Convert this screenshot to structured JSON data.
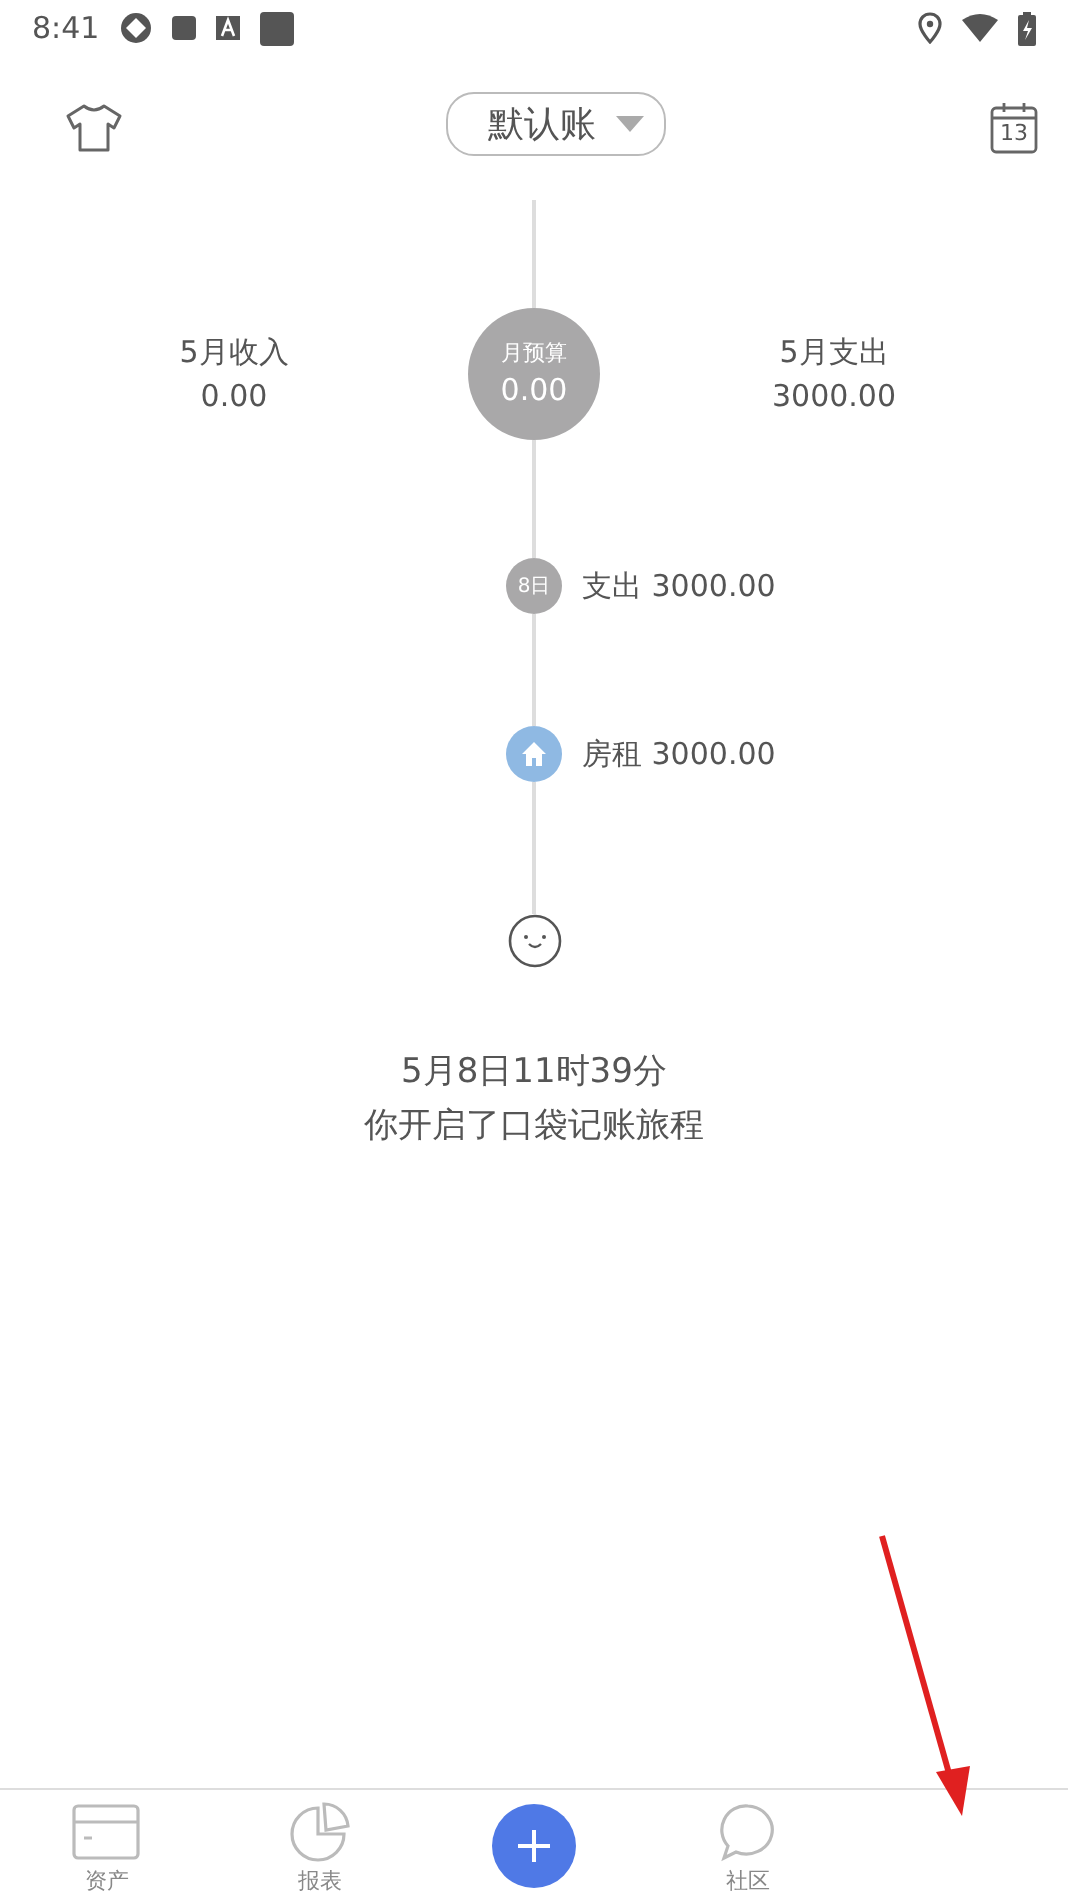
{
  "status_bar": {
    "time": "8:41"
  },
  "header": {
    "account": "默认账",
    "calendar_day": "13"
  },
  "summary": {
    "income": {
      "label": "5月收入",
      "amount": "0.00"
    },
    "budget": {
      "label": "月预算",
      "amount": "0.00"
    },
    "expense": {
      "label": "5月支出",
      "amount": "3000.00"
    }
  },
  "timeline": [
    {
      "kind": "date",
      "badge": "8日",
      "text": "支出 3000.00"
    },
    {
      "kind": "category",
      "text": "房租 3000.00"
    }
  ],
  "start": {
    "time": "5月8日11时39分",
    "message": "你开启了口袋记账旅程"
  },
  "nav": [
    {
      "kind": "card",
      "label": "资产"
    },
    {
      "kind": "pie",
      "label": "报表"
    },
    {
      "kind": "add"
    },
    {
      "kind": "chat",
      "label": "社区"
    }
  ]
}
